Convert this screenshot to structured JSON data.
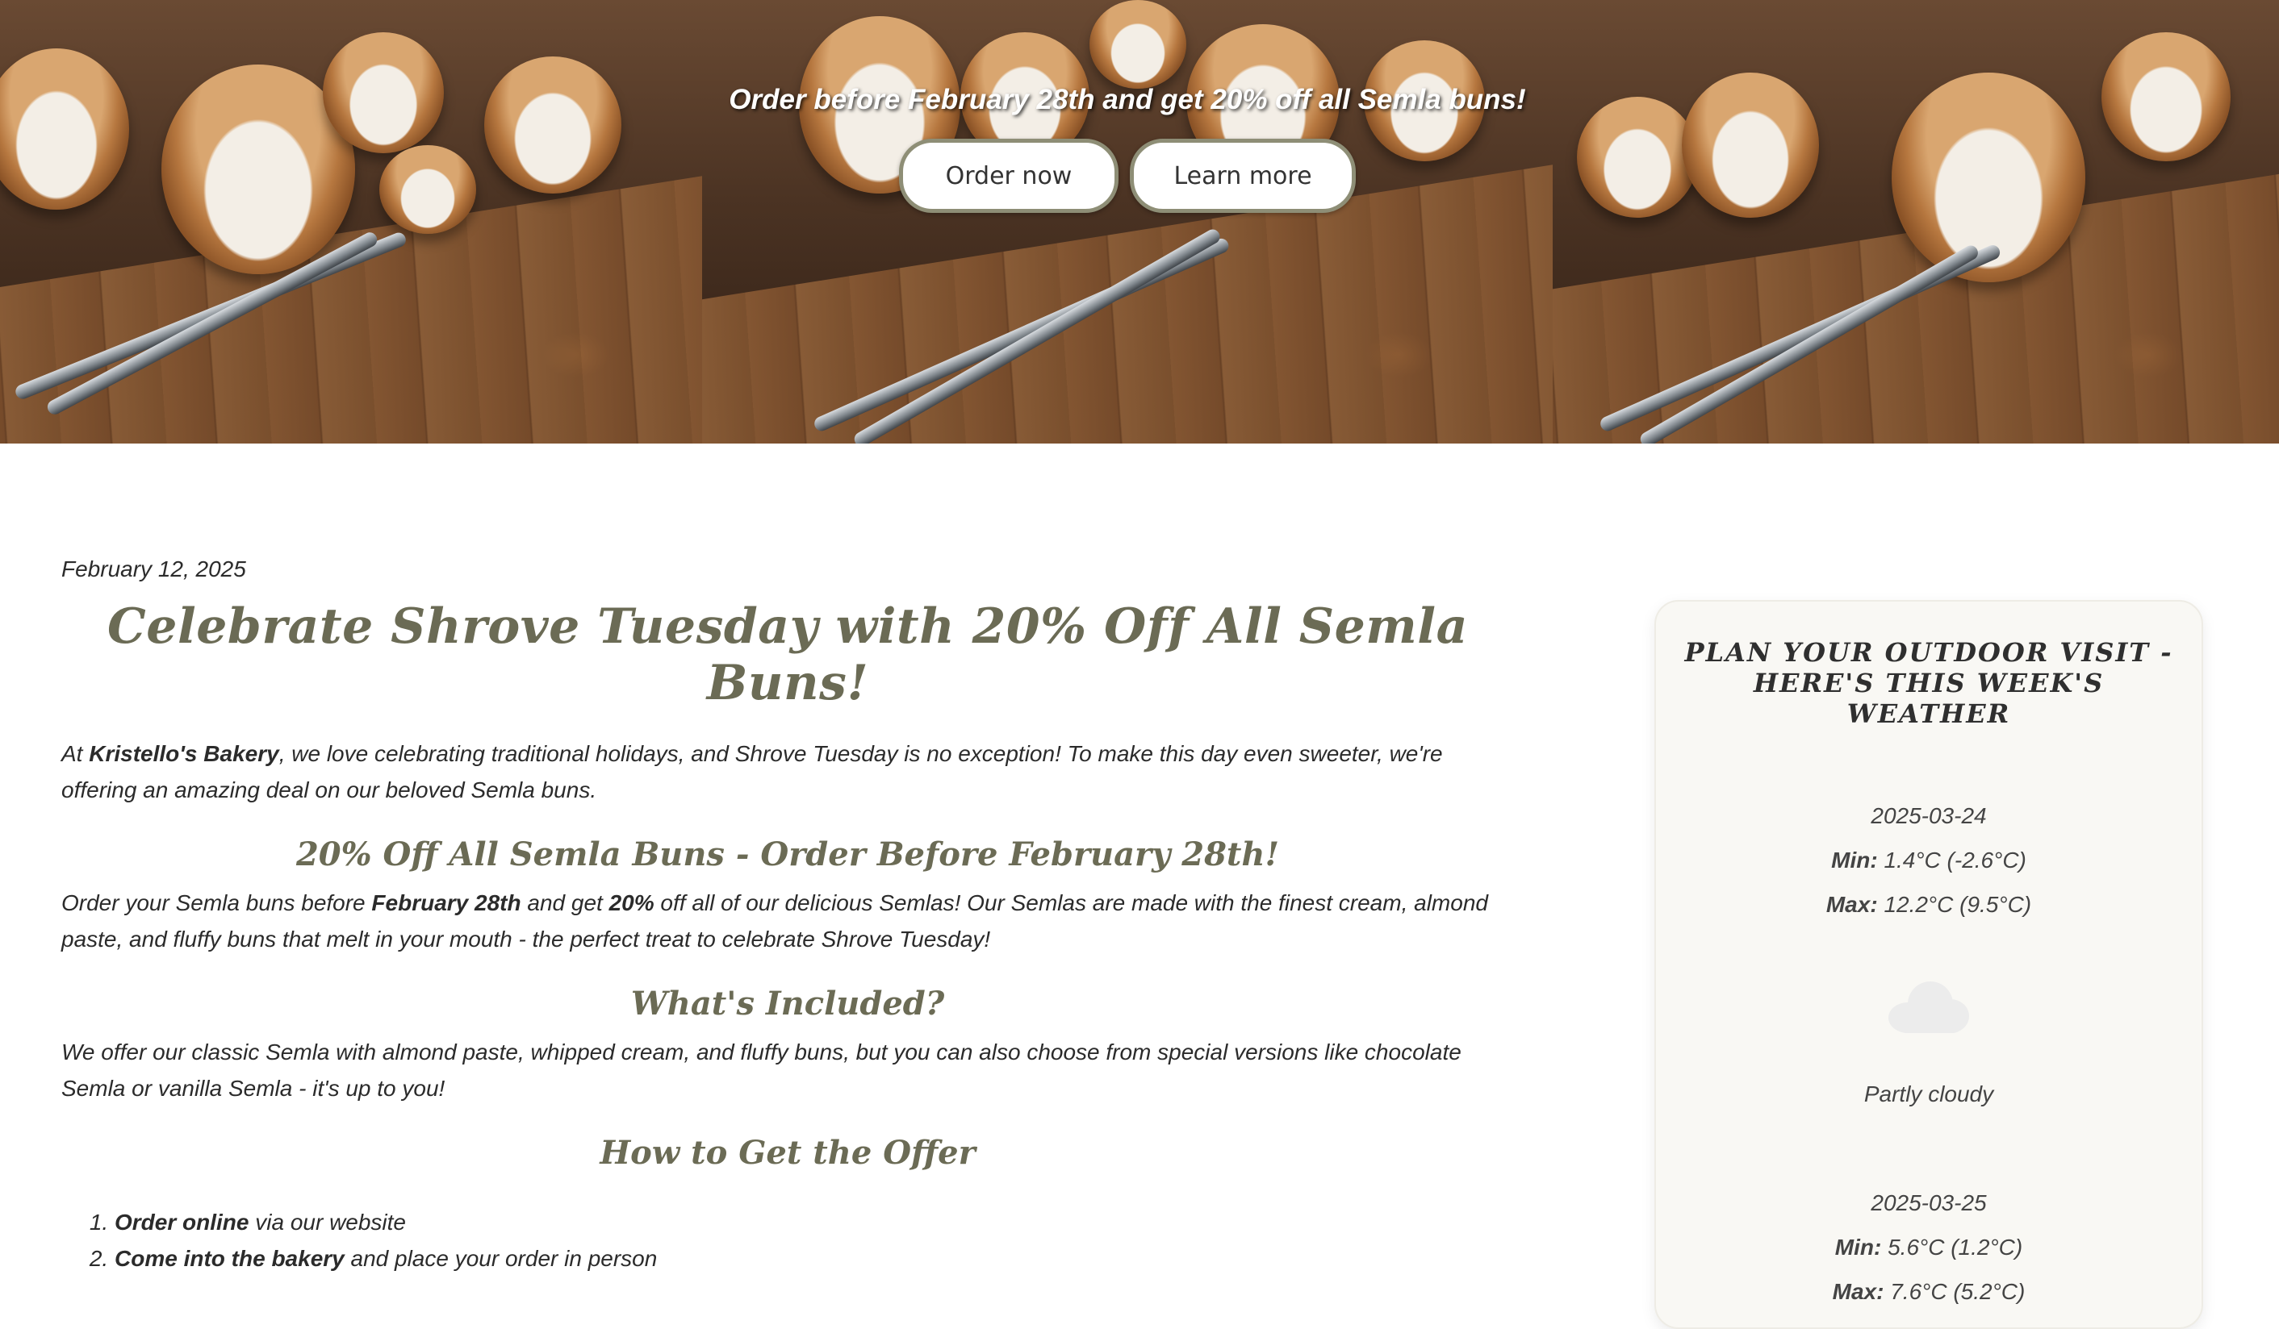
{
  "hero": {
    "promo_text": "Order before February 28th and get 20% off all Semla buns!",
    "order_button": "Order now",
    "learn_button": "Learn more"
  },
  "article": {
    "date": "February 12, 2025",
    "title": "Celebrate Shrove Tuesday with 20% Off All Semla Buns!",
    "intro_before": "At ",
    "intro_bold": "Kristello's Bakery",
    "intro_after": ", we love celebrating traditional holidays, and Shrove Tuesday is no exception! To make this day even sweeter, we're offering an amazing deal on our beloved Semla buns.",
    "section1_heading": "20% Off All Semla Buns - Order Before February 28th!",
    "section1_part1": "Order your Semla buns before ",
    "section1_bold1": "February 28th",
    "section1_part2": " and get ",
    "section1_bold2": "20%",
    "section1_part3": " off all of our delicious Semlas! Our Semlas are made with the finest cream, almond paste, and fluffy buns that melt in your mouth - the perfect treat to celebrate Shrove Tuesday!",
    "section2_heading": "What's Included?",
    "section2_text": "We offer our classic Semla with almond paste, whipped cream, and fluffy buns, but you can also choose from special versions like chocolate Semla or vanilla Semla - it's up to you!",
    "section3_heading": "How to Get the Offer",
    "steps": [
      {
        "bold": "Order online",
        "rest": " via our website"
      },
      {
        "bold": "Come into the bakery",
        "rest": " and place your order in person"
      }
    ]
  },
  "weather": {
    "title": "Plan your outdoor visit - here's this week's weather",
    "min_label": "Min:",
    "max_label": "Max:",
    "days": [
      {
        "date": "2025-03-24",
        "min": "1.4°C (-2.6°C)",
        "max": "12.2°C (9.5°C)",
        "icon": "cloud-icon",
        "condition": "Partly cloudy"
      },
      {
        "date": "2025-03-25",
        "min": "5.6°C (1.2°C)",
        "max": "7.6°C (5.2°C)"
      }
    ]
  }
}
